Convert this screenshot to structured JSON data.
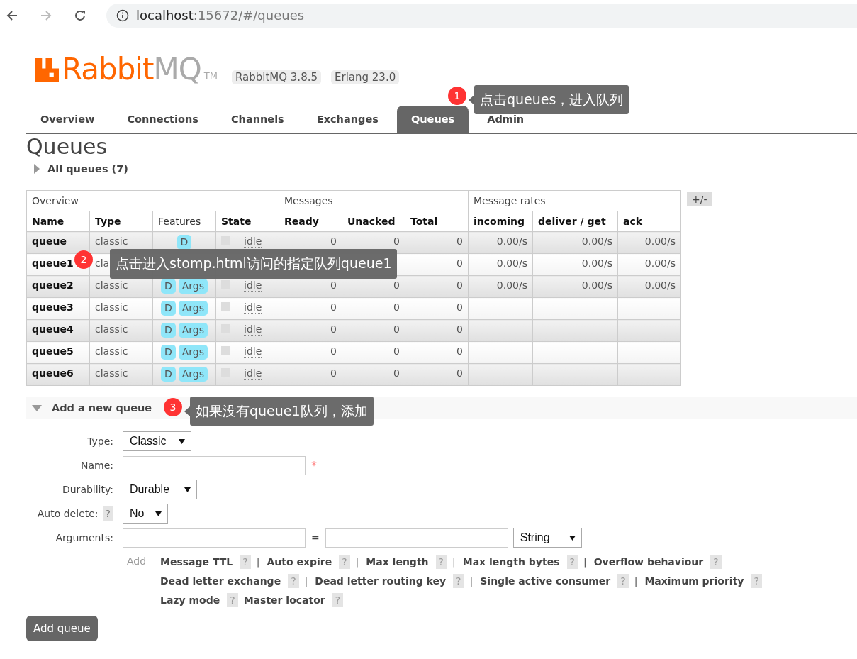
{
  "browser": {
    "address_host": "localhost",
    "address_rest": ":15672/#/queues"
  },
  "header": {
    "logo": {
      "primary": "Rabbit",
      "secondary": "MQ",
      "trademark": "TM"
    },
    "versions": [
      "RabbitMQ 3.8.5",
      "Erlang 23.0"
    ]
  },
  "tabs": [
    {
      "label": "Overview",
      "selected": false
    },
    {
      "label": "Connections",
      "selected": false
    },
    {
      "label": "Channels",
      "selected": false
    },
    {
      "label": "Exchanges",
      "selected": false
    },
    {
      "label": "Queues",
      "selected": true
    },
    {
      "label": "Admin",
      "selected": false
    }
  ],
  "page_title": "Queues",
  "all_queues": {
    "label": "All queues (7)",
    "expanded": false
  },
  "table": {
    "toggle_button": "+/-",
    "column_groups": [
      {
        "label": "Overview",
        "columns": [
          {
            "label": "Name",
            "sortable": true
          },
          {
            "label": "Type",
            "sortable": true
          },
          {
            "label": "Features",
            "sortable": false
          },
          {
            "label": "State",
            "sortable": true
          }
        ]
      },
      {
        "label": "Messages",
        "columns": [
          {
            "label": "Ready",
            "sortable": true
          },
          {
            "label": "Unacked",
            "sortable": true
          },
          {
            "label": "Total",
            "sortable": true
          }
        ]
      },
      {
        "label": "Message rates",
        "columns": [
          {
            "label": "incoming",
            "sortable": true
          },
          {
            "label": "deliver / get",
            "sortable": true
          },
          {
            "label": "ack",
            "sortable": true
          }
        ]
      }
    ],
    "rows": [
      {
        "name": "queue",
        "type": "classic",
        "features": [
          "D"
        ],
        "state": "idle",
        "ready": "0",
        "unacked": "0",
        "total": "0",
        "incoming": "0.00/s",
        "deliver_get": "0.00/s",
        "ack": "0.00/s"
      },
      {
        "name": "queue1",
        "type": "cla",
        "total": "0",
        "incoming": "0.00/s",
        "deliver_get": "0.00/s",
        "ack": "0.00/s"
      },
      {
        "name": "queue2",
        "type": "classic",
        "features": [
          "D",
          "Args"
        ],
        "state": "idle",
        "ready": "0",
        "unacked": "0",
        "total": "0",
        "incoming": "0.00/s",
        "deliver_get": "0.00/s",
        "ack": "0.00/s"
      },
      {
        "name": "queue3",
        "type": "classic",
        "features": [
          "D",
          "Args"
        ],
        "state": "idle",
        "ready": "0",
        "unacked": "0",
        "total": "0"
      },
      {
        "name": "queue4",
        "type": "classic",
        "features": [
          "D",
          "Args"
        ],
        "state": "idle",
        "ready": "0",
        "unacked": "0",
        "total": "0"
      },
      {
        "name": "queue5",
        "type": "classic",
        "features": [
          "D",
          "Args"
        ],
        "state": "idle",
        "ready": "0",
        "unacked": "0",
        "total": "0"
      },
      {
        "name": "queue6",
        "type": "classic",
        "features": [
          "D",
          "Args"
        ],
        "state": "idle",
        "ready": "0",
        "unacked": "0",
        "total": "0"
      }
    ]
  },
  "add_queue": {
    "title": "Add a new queue",
    "expanded": true,
    "fields": [
      {
        "kind": "select",
        "label": "Type:",
        "value": "Classic"
      },
      {
        "kind": "text",
        "label": "Name:",
        "required_mark": "*"
      },
      {
        "kind": "select",
        "label": "Durability:",
        "value": "Durable"
      },
      {
        "kind": "select",
        "label": "Auto delete:",
        "help": "?",
        "value": "No"
      },
      {
        "kind": "arguments",
        "label": "Arguments:",
        "equals": "=",
        "value_type": "String"
      }
    ],
    "shortcuts": {
      "add_label": "Add",
      "separator": "|",
      "help": "?",
      "rows": [
        {
          "separated": true,
          "items": [
            "Message TTL",
            "Auto expire",
            "Max length",
            "Max length bytes",
            "Overflow behaviour"
          ]
        },
        {
          "separated": true,
          "items": [
            "Dead letter exchange",
            "Dead letter routing key",
            "Single active consumer",
            "Maximum priority"
          ]
        },
        {
          "separated": false,
          "items": [
            "Lazy mode",
            "Master locator"
          ]
        }
      ]
    },
    "submit": "Add queue"
  },
  "annotations": [
    {
      "number": "1",
      "text": "点击queues，进入队列",
      "pointer": true
    },
    {
      "number": "2",
      "text": "点击进入stomp.html访问的指定队列queue1",
      "pointer": false
    },
    {
      "number": "3",
      "text": "如果没有queue1队列，添加",
      "pointer": true
    }
  ]
}
